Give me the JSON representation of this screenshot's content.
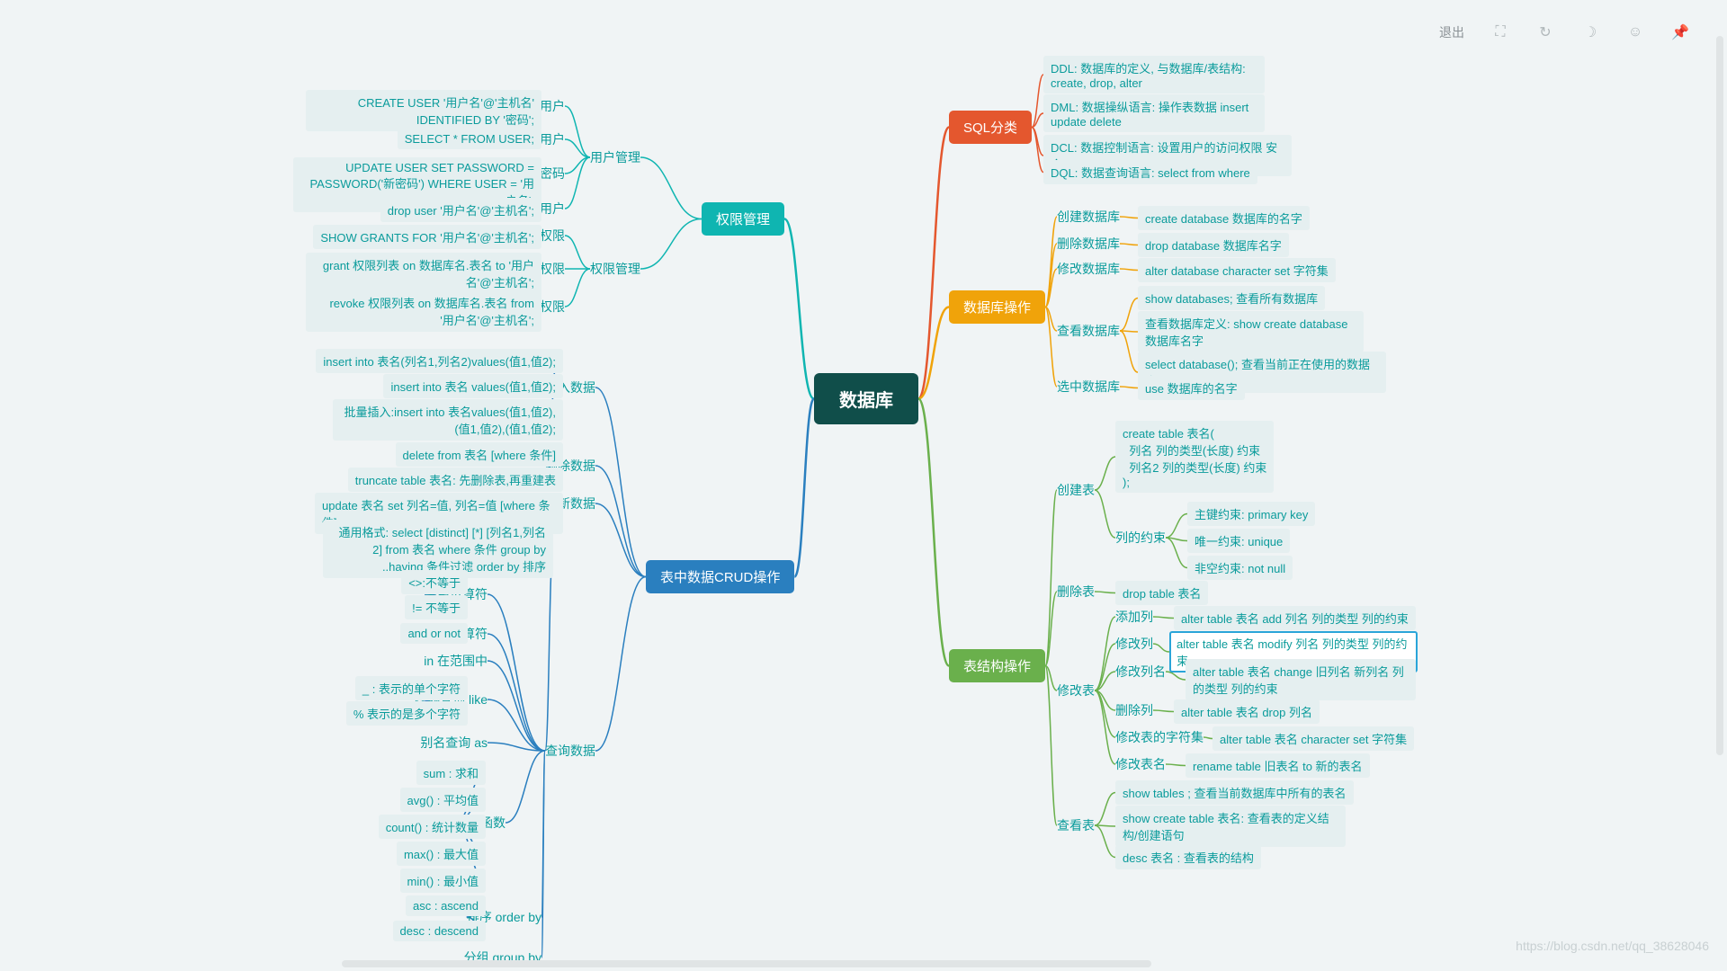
{
  "toolbar": {
    "exit": "退出"
  },
  "watermark": "https://blog.csdn.net/qq_38628046",
  "root": "数据库",
  "major": {
    "sql": "SQL分类",
    "dbop": "数据库操作",
    "tbop": "表结构操作",
    "crud": "表中数据CRUD操作",
    "perm": "权限管理"
  },
  "colors": {
    "sql": "#e4572e",
    "dbop": "#f0a30a",
    "tbop": "#6ab04c",
    "crud": "#2a7fbf",
    "perm": "#0fb5b1"
  },
  "sql": {
    "ddl": "DDL: 数据库的定义, 与数据库/表结构: create, drop, alter",
    "dml": "DML: 数据操纵语言: 操作表数据 insert update delete",
    "dcl": "DCL: 数据控制语言: 设置用户的访问权限  安全",
    "dql": "DQL: 数据查询语言: select  from where"
  },
  "dbop": {
    "create": {
      "label": "创建数据库",
      "cmd": "create database 数据库的名字"
    },
    "drop": {
      "label": "删除数据库",
      "cmd": "drop database 数据库名字"
    },
    "alter": {
      "label": "修改数据库",
      "cmd": "alter database character set 字符集"
    },
    "show": {
      "label": "查看数据库",
      "a": "show databases; 查看所有数据库",
      "b": "查看数据库定义: show create database 数据库名字",
      "c": "select database();  查看当前正在使用的数据库"
    },
    "use": {
      "label": "选中数据库",
      "cmd": "use 数据库的名字"
    }
  },
  "tbop": {
    "create": {
      "label": "创建表",
      "def": "create table 表名(\n  列名 列的类型(长度) 约束\n  列名2 列的类型(长度) 约束\n);",
      "constr": {
        "label": "列的约束",
        "pk": "主键约束: primary key",
        "uq": "唯一约束: unique",
        "nn": "非空约束: not null"
      }
    },
    "drop": {
      "label": "删除表",
      "cmd": "drop table 表名"
    },
    "alter": {
      "label": "修改表",
      "addcol": {
        "label": "添加列",
        "cmd": "alter table 表名 add 列名 列的类型 列的约束"
      },
      "modcol": {
        "label": "修改列",
        "cmd": "alter table 表名 modify 列名 列的类型 列的约束"
      },
      "chgcol": {
        "label": "修改列名",
        "cmd": "alter table 表名 change 旧列名 新列名 列的类型 列的约束"
      },
      "dropcol": {
        "label": "删除列",
        "cmd": "alter table 表名 drop 列名"
      },
      "charset": {
        "label": "修改表的字符集",
        "cmd": "alter table 表名 character set 字符集"
      },
      "rename": {
        "label": "修改表名",
        "cmd": "rename table 旧表名 to 新的表名"
      }
    },
    "show": {
      "label": "查看表",
      "a": "show tables ; 查看当前数据库中所有的表名",
      "b": "show create table 表名: 查看表的定义结构/创建语句",
      "c": "desc 表名 : 查看表的结构"
    }
  },
  "crud": {
    "insert": {
      "label": "插入数据",
      "a": "insert into 表名(列名1,列名2)values(值1,值2);",
      "b": "insert into 表名 values(值1,值2);",
      "c": "批量插入:insert into 表名values(值1,值2),(值1,值2),(值1,值2);"
    },
    "delete": {
      "label": "删除数据",
      "a": "delete from 表名 [where 条件]",
      "b": "truncate table 表名: 先删除表,再重建表"
    },
    "update": {
      "label": "更新数据",
      "cmd": "update 表名 set 列名=值, 列名=值 [where 条件]"
    },
    "select": {
      "label": "查询数据",
      "general": "通用格式: select [distinct] [*] [列名1,列名2] from 表名 where 条件 group by ..having 条件过滤 order by 排序",
      "relop": {
        "label": "关系运算符",
        "a": "<>:不等于",
        "b": "!= 不等于"
      },
      "logic": {
        "label": "逻辑运算符",
        "a": "and or not"
      },
      "in": {
        "label": "in 在范围中"
      },
      "like": {
        "label": "模糊查询 like",
        "a": "_ : 表示的单个字符",
        "b": "% 表示的是多个字符"
      },
      "alias": {
        "label": "别名查询 as"
      },
      "agg": {
        "label": "聚合函数",
        "sum": "sum :  求和",
        "avg": "avg() :  平均值",
        "count": "count() : 统计数量",
        "max": "max() :  最大值",
        "min": "min() :  最小值"
      },
      "order": {
        "label": "排序 order by",
        "asc": "asc : ascend",
        "desc": "desc : descend"
      },
      "group": {
        "label": "分组 group by"
      }
    }
  },
  "perm": {
    "user": {
      "label": "用户管理",
      "create": {
        "label": "创建用户",
        "cmd": "CREATE USER '用户名'@'主机名' IDENTIFIED BY '密码';"
      },
      "query": {
        "label": "查询用户",
        "cmd": "SELECT * FROM USER;"
      },
      "pwd": {
        "label": "修改用户密码",
        "cmd": "UPDATE USER SET PASSWORD = PASSWORD('新密码') WHERE USER = '用户名';"
      },
      "drop": {
        "label": "删除用户",
        "cmd": "drop user '用户名'@'主机名';"
      }
    },
    "auth": {
      "label": "权限管理",
      "show": {
        "label": "查询权限",
        "cmd": "SHOW GRANTS FOR '用户名'@'主机名';"
      },
      "grant": {
        "label": "授予权限",
        "cmd": "grant 权限列表 on 数据库名.表名 to '用户名'@'主机名';"
      },
      "revoke": {
        "label": "撤销权限",
        "cmd": "revoke 权限列表 on 数据库名.表名 from '用户名'@'主机名';"
      }
    }
  }
}
